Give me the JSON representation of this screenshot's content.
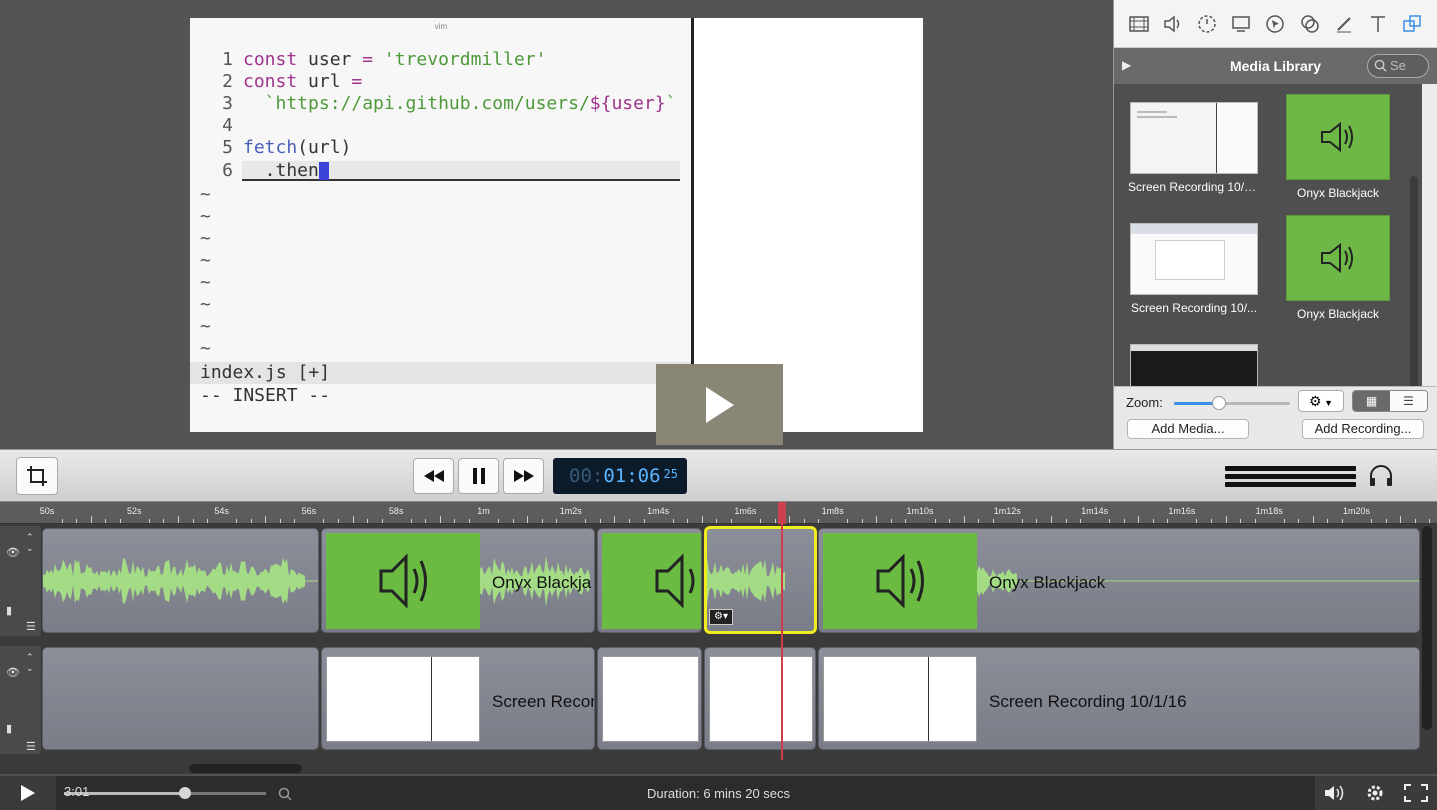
{
  "vim": {
    "window_title": "vim",
    "lines": [
      {
        "num": "1",
        "code": [
          {
            "t": "const ",
            "c": "kw"
          },
          {
            "t": "user ",
            "c": ""
          },
          {
            "t": "= ",
            "c": "kw"
          },
          {
            "t": "'trevordmiller'",
            "c": "str"
          }
        ]
      },
      {
        "num": "2",
        "code": [
          {
            "t": "const ",
            "c": "kw"
          },
          {
            "t": "url ",
            "c": ""
          },
          {
            "t": "=",
            "c": "kw"
          }
        ]
      },
      {
        "num": "3",
        "code": [
          {
            "t": "  `https://api.github.com/users/",
            "c": "str"
          },
          {
            "t": "${user}",
            "c": "kw"
          },
          {
            "t": "`",
            "c": "str"
          }
        ]
      },
      {
        "num": "4",
        "code": []
      },
      {
        "num": "5",
        "code": [
          {
            "t": "fetch",
            "c": "fn"
          },
          {
            "t": "(url)",
            "c": ""
          }
        ]
      },
      {
        "num": "6",
        "code": [
          {
            "t": "  .then",
            "c": ""
          }
        ]
      }
    ],
    "tildes": [
      "~",
      "~",
      "~",
      "~",
      "~",
      "~",
      "~",
      "~"
    ],
    "statusline": "index.js [+]",
    "mode": "-- INSERT --"
  },
  "media_library": {
    "title": "Media Library",
    "search_placeholder": "Se",
    "toolbar_icons": [
      "clips-icon",
      "audio-icon",
      "animations-icon",
      "screen-icon",
      "cursor-icon",
      "effects-icon",
      "annotations-icon",
      "text-icon",
      "media-library-icon"
    ],
    "items": [
      {
        "type": "video",
        "label": "Screen Recording 10/1..."
      },
      {
        "type": "audio",
        "label": "Onyx Blackjack"
      },
      {
        "type": "video",
        "label": "Screen Recording 10/..."
      },
      {
        "type": "audio",
        "label": "Onyx Blackjack"
      },
      {
        "type": "video",
        "label": ""
      }
    ],
    "zoom_label": "Zoom:",
    "zoom_value": 0.4,
    "add_media_label": "Add Media...",
    "add_recording_label": "Add Recording..."
  },
  "transport": {
    "timecode_dim": "00:",
    "timecode_main": "01:06",
    "timecode_frames": "25"
  },
  "timeline": {
    "ticks": [
      "50s",
      "52s",
      "54s",
      "56s",
      "58s",
      "1m",
      "1m2s",
      "1m4s",
      "1m6s",
      "1m8s",
      "1m10s",
      "1m12s",
      "1m14s",
      "1m16s",
      "1m18s",
      "1m20s"
    ],
    "audio_clip_label_1": "Onyx Blackja",
    "audio_clip_label_2": "Onyx Blackjack",
    "video_clip_label_1": "Screen Recor",
    "video_clip_label_2": "Screen Recording 10/1/16"
  },
  "player": {
    "current_time": "3:01",
    "progress": 0.6,
    "duration_text": "Duration: 6 mins 20 secs"
  },
  "colors": {
    "audio_green": "#6bbb43",
    "playhead": "#d33a4b",
    "selection": "#f1ec1f",
    "timecode_blue": "#5ab4ff"
  }
}
